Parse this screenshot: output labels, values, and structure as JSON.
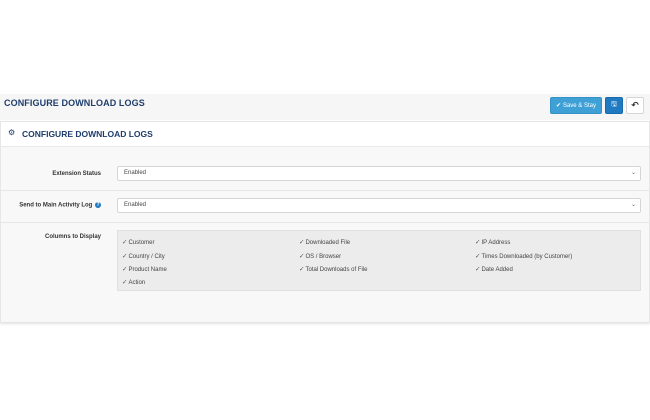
{
  "header": {
    "title": "CONFIGURE DOWNLOAD LOGS",
    "save_stay_label": "Save & Stay",
    "save_icon": "floppy-disk-icon",
    "back_icon": "reply-arrow-icon"
  },
  "panel": {
    "title": "CONFIGURE DOWNLOAD LOGS",
    "icon": "cogs-icon"
  },
  "form": {
    "extension_status": {
      "label": "Extension Status",
      "value": "Enabled"
    },
    "send_to_main_log": {
      "label": "Send to Main Activity Log",
      "value": "Enabled"
    },
    "columns": {
      "label": "Columns to Display",
      "items": [
        "Customer",
        "Downloaded File",
        "IP Address",
        "Country / City",
        "OS / Browser",
        "Times Downloaded (by Customer)",
        "Product Name",
        "Total Downloads of File",
        "Date Added",
        "Action"
      ]
    }
  },
  "colors": {
    "accent": "#1e3d6b",
    "save": "#3fa0d6",
    "primary": "#1f7ac2"
  }
}
